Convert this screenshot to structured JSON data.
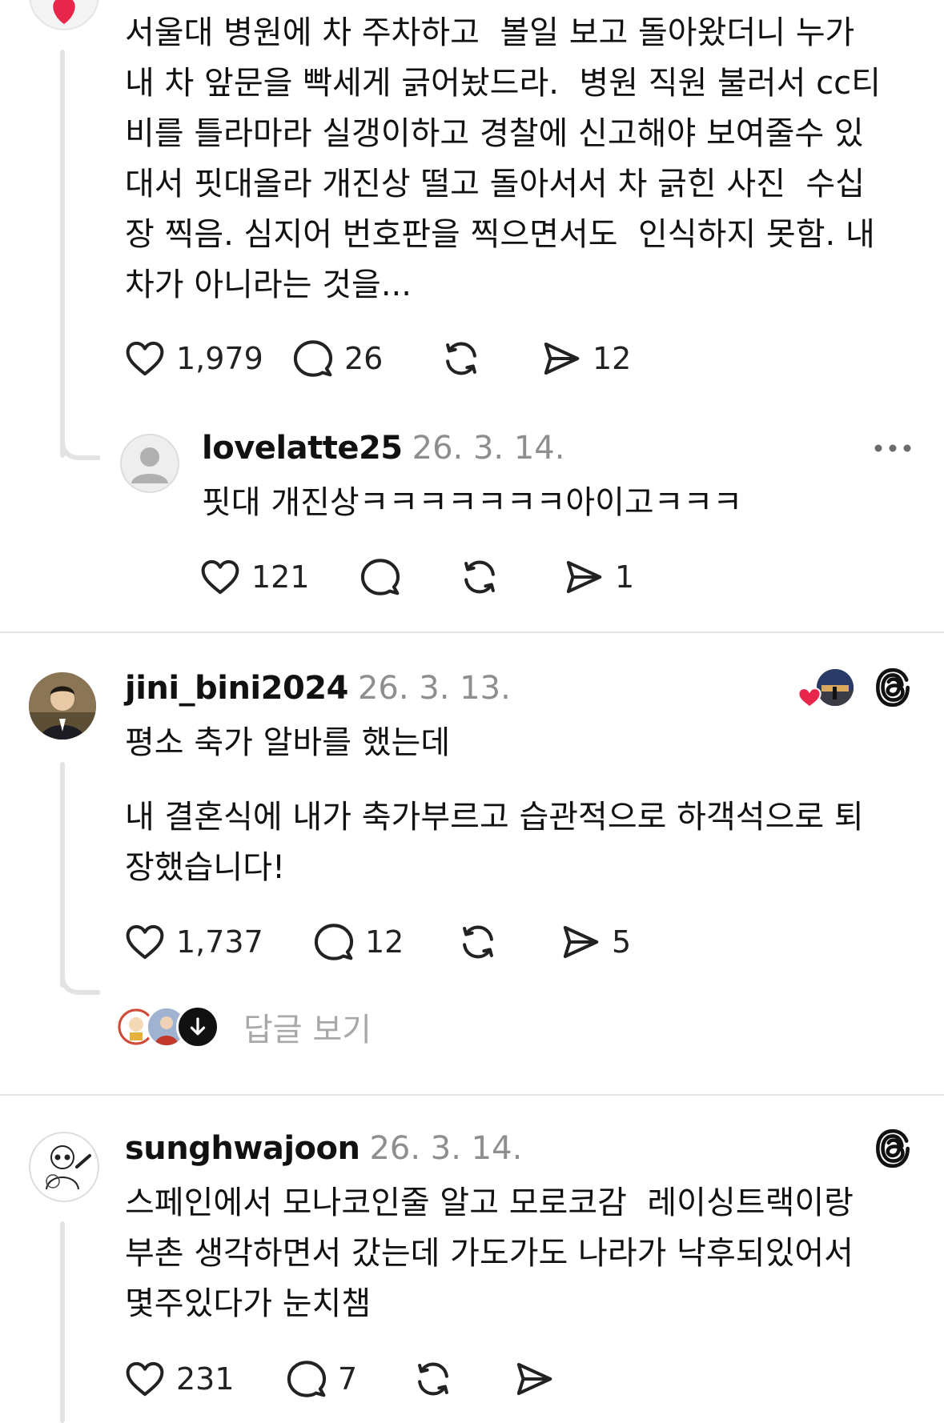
{
  "comments": [
    {
      "text": "서울대 병원에 차 주차하고  볼일 보고 돌아왔더니 누가\n내 차 앞문을 빡세게 긁어놨드라.  병원 직원 불러서 cc티\n비를 틀라마라 실갱이하고 경찰에 신고해야 보여줄수 있\n대서 핏대올라 개진상 떨고 돌아서서 차 긁힌 사진  수십\n장 찍음. 심지어 번호판을 찍으면서도  인식하지 못함. 내\n차가 아니라는 것을...",
      "likes": "1,979",
      "comments": "26",
      "shares": "12",
      "reply": {
        "username": "lovelatte25",
        "date": "26. 3. 14.",
        "text": "핏대 개진상ㅋㅋㅋㅋㅋㅋㅋ아이고ㅋㅋㅋ",
        "likes": "121",
        "shares": "1"
      }
    },
    {
      "username": "jini_bini2024",
      "date": "26. 3. 13.",
      "text_line1": "평소 축가 알바를 했는데",
      "text_line2": "내 결혼식에 내가 축가부르고 습관적으로 하객석으로 퇴\n장했습니다!",
      "likes": "1,737",
      "comments": "12",
      "shares": "5",
      "view_replies": "답글 보기"
    },
    {
      "username": "sunghwajoon",
      "date": "26. 3. 14.",
      "text": "스페인에서 모나코인줄 알고 모로코감  레이싱트랙이랑\n부촌 생각하면서 갔는데 가도가도 나라가 낙후되있어서\n몇주있다가 눈치챔",
      "likes": "231",
      "comments": "7"
    }
  ],
  "colors": {
    "heart_red": "#e8264b",
    "separator": "#e5e5e5",
    "thread_line": "#e3e3e3",
    "muted": "#8e8e8e"
  }
}
